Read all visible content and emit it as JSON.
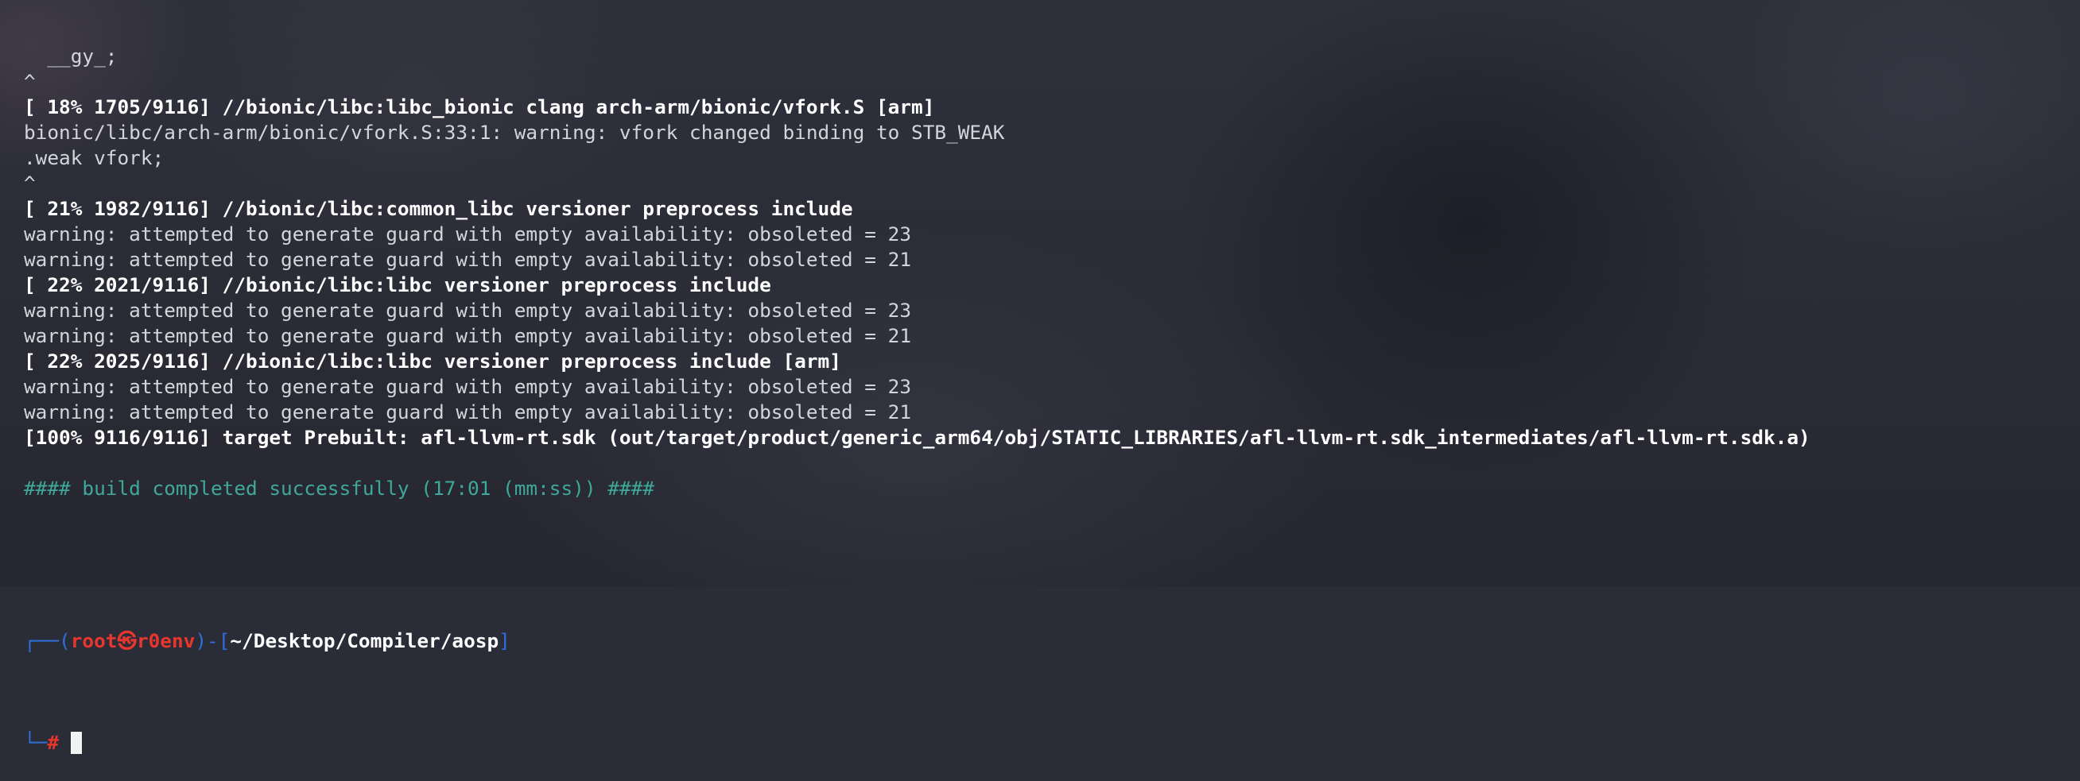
{
  "terminal": {
    "lines": [
      {
        "text": "  __gy_;",
        "style": "normal"
      },
      {
        "text": "^",
        "style": "normal"
      },
      {
        "text": "[ 18% 1705/9116] //bionic/libc:libc_bionic clang arch-arm/bionic/vfork.S [arm]",
        "style": "bold"
      },
      {
        "text": "bionic/libc/arch-arm/bionic/vfork.S:33:1: warning: vfork changed binding to STB_WEAK",
        "style": "normal"
      },
      {
        "text": ".weak vfork;",
        "style": "normal"
      },
      {
        "text": "^",
        "style": "normal"
      },
      {
        "text": "[ 21% 1982/9116] //bionic/libc:common_libc versioner preprocess include",
        "style": "bold"
      },
      {
        "text": "warning: attempted to generate guard with empty availability: obsoleted = 23",
        "style": "normal"
      },
      {
        "text": "warning: attempted to generate guard with empty availability: obsoleted = 21",
        "style": "normal"
      },
      {
        "text": "[ 22% 2021/9116] //bionic/libc:libc versioner preprocess include",
        "style": "bold"
      },
      {
        "text": "warning: attempted to generate guard with empty availability: obsoleted = 23",
        "style": "normal"
      },
      {
        "text": "warning: attempted to generate guard with empty availability: obsoleted = 21",
        "style": "normal"
      },
      {
        "text": "[ 22% 2025/9116] //bionic/libc:libc versioner preprocess include [arm]",
        "style": "bold"
      },
      {
        "text": "warning: attempted to generate guard with empty availability: obsoleted = 23",
        "style": "normal"
      },
      {
        "text": "warning: attempted to generate guard with empty availability: obsoleted = 21",
        "style": "normal"
      },
      {
        "text": "[100% 9116/9116] target Prebuilt: afl-llvm-rt.sdk (out/target/product/generic_arm64/obj/STATIC_LIBRARIES/afl-llvm-rt.sdk_intermediates/afl-llvm-rt.sdk.a)",
        "style": "bold"
      },
      {
        "text": "",
        "style": "normal"
      },
      {
        "text": "#### build completed successfully (17:01 (mm:ss)) ####",
        "style": "success"
      },
      {
        "text": "",
        "style": "normal"
      },
      {
        "text": "",
        "style": "normal"
      }
    ],
    "prompt": {
      "box_top_left": "┌──(",
      "user": "root",
      "skull": "㉿",
      "host": "r0env",
      "mid": ")-[",
      "path": "~/Desktop/Compiler/aosp",
      "close": "]",
      "box_bottom_left": "└─",
      "symbol": "#"
    }
  }
}
